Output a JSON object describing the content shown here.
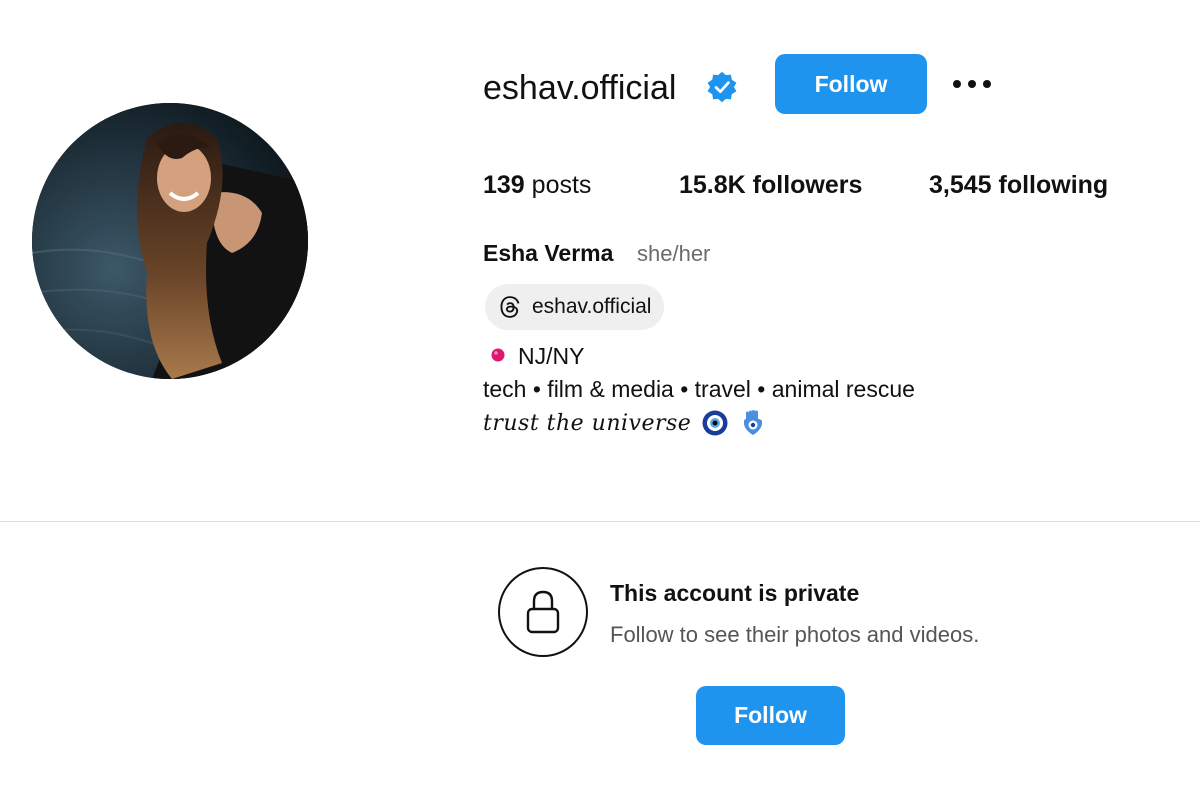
{
  "profile": {
    "username": "eshav.official",
    "verified": true,
    "follow_label": "Follow",
    "more_icon": "more-horizontal-icon",
    "avatar_alt": "profile photo"
  },
  "stats": {
    "posts_count": "139",
    "posts_label": " posts",
    "followers_count": "15.8K",
    "followers_label": " followers",
    "following_count": "3,545",
    "following_label": " following"
  },
  "bio": {
    "full_name": "Esha Verma",
    "pronouns": "she/her",
    "threads_handle": "eshav.official",
    "location": "NJ/NY",
    "interests": "tech • film & media • travel • animal rescue",
    "motto": "trust the universe",
    "motto_emojis": [
      "nazar-amulet-icon",
      "hamsa-icon"
    ]
  },
  "private_notice": {
    "title": "This account is private",
    "subtitle": "Follow to see their photos and videos.",
    "follow_label": "Follow"
  },
  "colors": {
    "accent": "#1e94ef",
    "pin": "#e0176f",
    "muted_text": "#6b6b6b",
    "divider": "#dbdbdb"
  }
}
